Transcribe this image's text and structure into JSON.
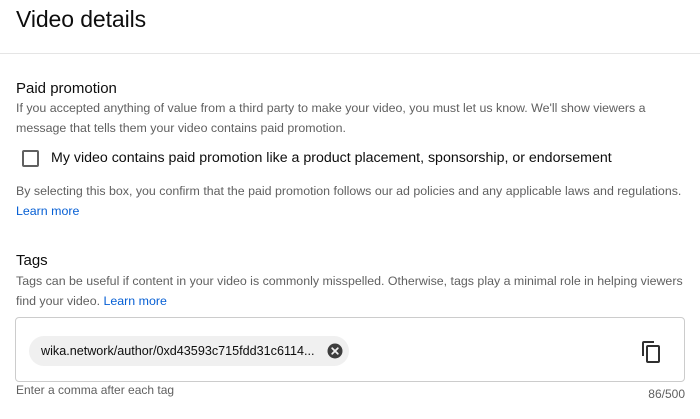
{
  "header": {
    "title": "Video details"
  },
  "paid_promotion": {
    "title": "Paid promotion",
    "description": "If you accepted anything of value from a third party to make your video, you must let us know. We'll show viewers a message that tells them your video contains paid promotion.",
    "checkbox_label": "My video contains paid promotion like a product placement, sponsorship, or endorsement",
    "checkbox_checked": false,
    "confirm_text": "By selecting this box, you confirm that the paid promotion follows our ad policies and any applicable laws and regulations.",
    "learn_more": "Learn more"
  },
  "tags": {
    "title": "Tags",
    "description": "Tags can be useful if content in your video is commonly misspelled. Otherwise, tags play a minimal role in helping viewers find your video.",
    "learn_more": "Learn more",
    "items": [
      {
        "label": "wika.network/author/0xd43593c715fdd31c6114..."
      }
    ],
    "hint": "Enter a comma after each tag",
    "counter": "86/500"
  },
  "icons": {
    "chip_remove": "close-circle-icon",
    "copy": "copy-icon"
  },
  "colors": {
    "link": "#065fd4",
    "secondary_text": "#606060",
    "chip_bg": "#f0f0f0"
  }
}
